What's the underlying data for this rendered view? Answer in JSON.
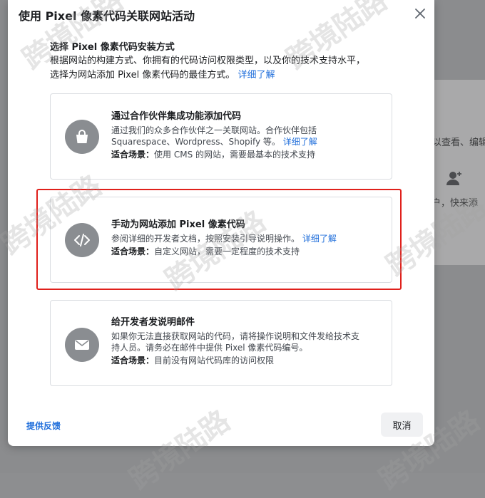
{
  "background": {
    "text_1": "以查看、编辑",
    "text_2": "用户，快来添",
    "icon": "user-add-icon"
  },
  "dialog": {
    "title": "使用 Pixel 像素代码关联网站活动",
    "close_icon": "close-icon",
    "section_title": "选择 Pixel 像素代码安装方式",
    "intro_line1": "根据网站的构建方式、你拥有的代码访问权限类型，以及你的技术支持水平，",
    "intro_line2": "选择为网站添加 Pixel 像素代码的最佳方式。",
    "intro_link": "详细了解",
    "options": [
      {
        "icon": "shopping-bag-icon",
        "title": "通过合作伙伴集成功能添加代码",
        "desc_line1": "通过我们的众多合作伙伴之一关联网站。合作伙伴包括",
        "desc_line2": "Squarespace、Wordpress、Shopify 等。",
        "link": "详细了解",
        "scene_label": "适合场景：",
        "scene_text": "使用 CMS 的网站，需要最基本的技术支持"
      },
      {
        "icon": "code-icon",
        "title": "手动为网站添加 Pixel 像素代码",
        "desc_line1": "参阅详细的开发者文档，按照安装引导说明操作。",
        "link": "详细了解",
        "scene_label": "适合场景：",
        "scene_text": "自定义网站，需要一定程度的技术支持"
      },
      {
        "icon": "envelope-icon",
        "title": "给开发者发说明邮件",
        "desc_line1": "如果你无法直接获取网站的代码，请将操作说明和文件发给技术支",
        "desc_line2": "持人员。请务必在邮件中提供 Pixel 像素代码编号。",
        "scene_label": "适合场景：",
        "scene_text": "目前没有网站代码库的访问权限"
      }
    ],
    "feedback_link": "提供反馈",
    "cancel_label": "取消"
  },
  "watermark": "跨境陆路",
  "colors": {
    "link": "#216fdb",
    "highlight": "#e0201b",
    "icon_bg": "#8a8d91"
  }
}
